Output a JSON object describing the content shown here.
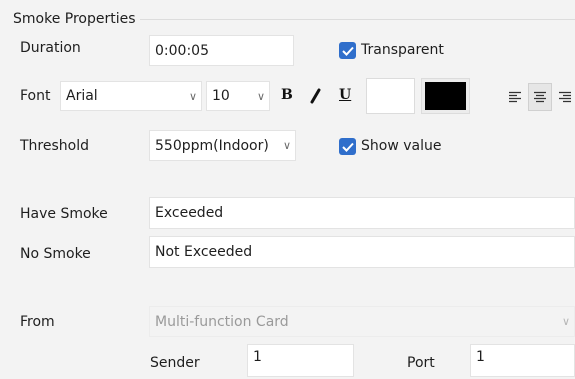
{
  "section_title": "Smoke Properties",
  "duration": {
    "label": "Duration",
    "value": "0:00:05"
  },
  "transparent": {
    "label": "Transparent",
    "checked": true
  },
  "font": {
    "label": "Font",
    "family": "Arial",
    "size": "10",
    "bold_label": "B",
    "italic_label": "I",
    "underline_label": "U",
    "bg_color": "#ffffff",
    "fg_color": "#000000"
  },
  "alignment": {
    "options": [
      "left",
      "center",
      "right"
    ],
    "selected": "center"
  },
  "threshold": {
    "label": "Threshold",
    "value": "550ppm(Indoor)"
  },
  "show_value": {
    "label": "Show value",
    "checked": true
  },
  "have_smoke": {
    "label": "Have Smoke",
    "value": "Exceeded"
  },
  "no_smoke": {
    "label": "No Smoke",
    "value": "Not Exceeded"
  },
  "from": {
    "label": "From",
    "value": "Multi-function Card"
  },
  "sender": {
    "label": "Sender",
    "value": "1"
  },
  "port": {
    "label": "Port",
    "value": "1"
  },
  "accent_color": "#2f6ecb"
}
